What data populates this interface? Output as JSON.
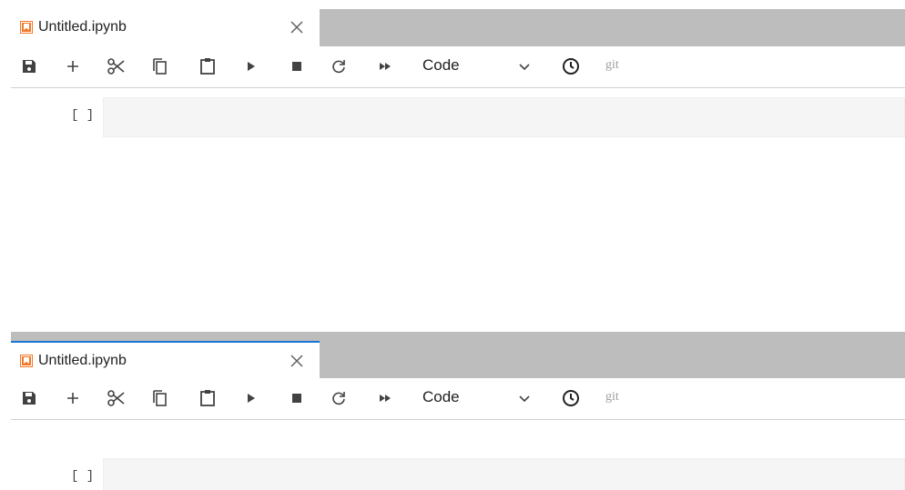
{
  "panels": [
    {
      "tab": {
        "title": "Untitled.ipynb",
        "icon": "notebook-icon",
        "close_icon": "close-icon",
        "active": false
      },
      "toolbar": {
        "buttons": [
          "save-icon",
          "add-icon",
          "cut-icon",
          "copy-icon",
          "paste-icon",
          "run-icon",
          "stop-icon",
          "restart-icon",
          "fast-forward-icon"
        ],
        "cell_type": "Code",
        "clock_icon": "clock-icon",
        "git_label": "git"
      },
      "cell": {
        "prompt": "[ ]",
        "content": ""
      }
    },
    {
      "tab": {
        "title": "Untitled.ipynb",
        "icon": "notebook-icon",
        "close_icon": "close-icon",
        "active": true
      },
      "toolbar": {
        "buttons": [
          "save-icon",
          "add-icon",
          "cut-icon",
          "copy-icon",
          "paste-icon",
          "run-icon",
          "stop-icon",
          "restart-icon",
          "fast-forward-icon"
        ],
        "cell_type": "Code",
        "clock_icon": "clock-icon",
        "git_label": "git"
      },
      "cell": {
        "prompt": "[ ]",
        "content": ""
      }
    }
  ],
  "colors": {
    "notebook_icon": "#f37726",
    "active_tab_border": "#1976d2",
    "tabbar_bg": "#bdbdbd",
    "cell_bg": "#f5f5f5"
  }
}
